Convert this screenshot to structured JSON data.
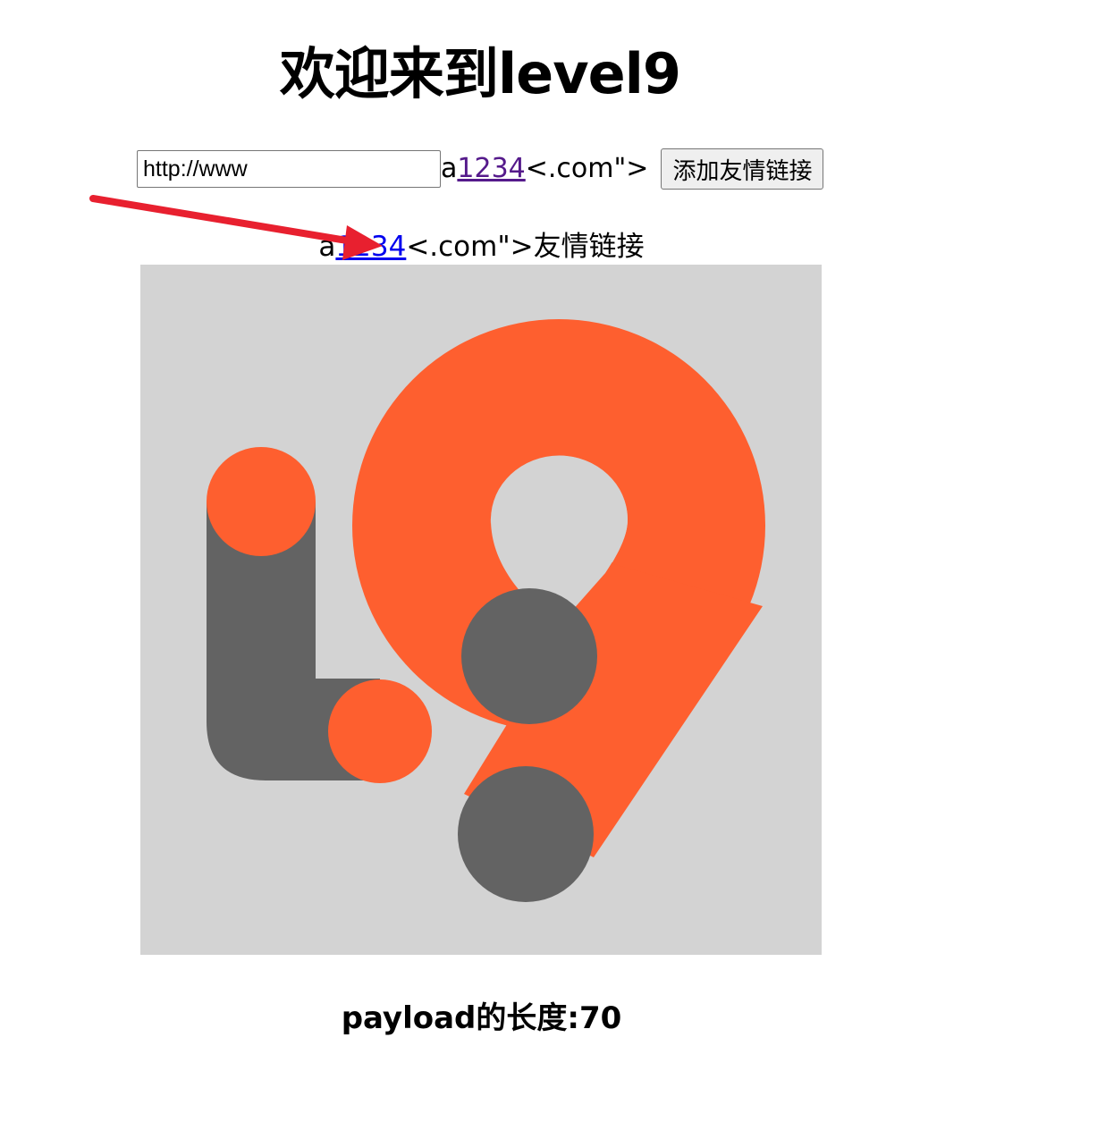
{
  "header": {
    "title": "欢迎来到level9"
  },
  "form": {
    "url_input_value": "http://www",
    "reflected_prefix": "a",
    "reflected_link_text": "1234",
    "reflected_suffix": "<.com\">",
    "submit_label": "添加友情链接"
  },
  "friend_link": {
    "prefix": "a",
    "link_text": "1234",
    "suffix": "<.com\">友情链接"
  },
  "logo": {
    "icon": "level9-logo",
    "colors": {
      "background": "#d3d3d3",
      "orange": "#fe5f2f",
      "gray": "#636363"
    }
  },
  "footer": {
    "payload_length_text": "payload的长度:70"
  },
  "annotation": {
    "icon": "red-arrow-icon",
    "color": "#e8202f"
  }
}
